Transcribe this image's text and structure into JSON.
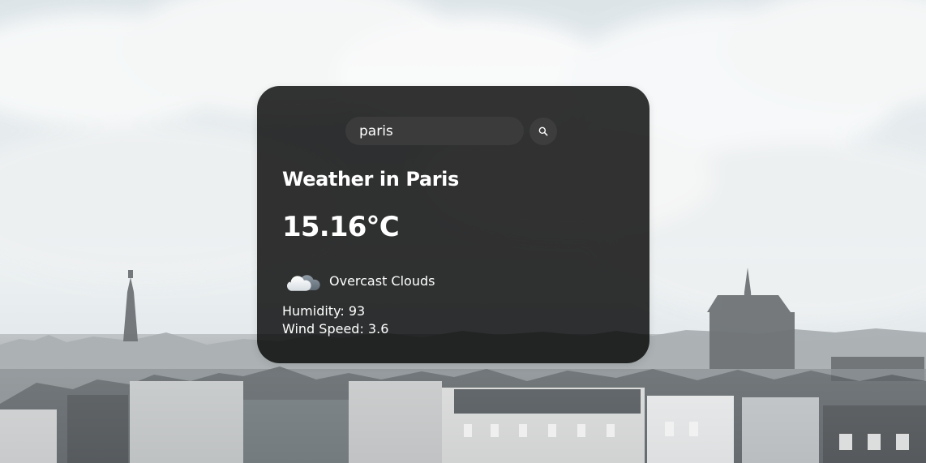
{
  "search": {
    "value": "paris",
    "placeholder": "Search"
  },
  "weather": {
    "title": "Weather in Paris",
    "temperature": "15.16°C",
    "condition": "Overcast Clouds",
    "condition_icon": "cloud-icon",
    "humidity": "Humidity: 93",
    "wind_speed": "Wind Speed: 3.6"
  },
  "theme": {
    "card_background": "#000000",
    "card_opacity": 0.8,
    "text_color": "#ffffff",
    "search_background": "#3b3b3b",
    "search_button_background": "#3d3d3d"
  },
  "icons": {
    "search": "search-icon",
    "weather": "cloud-icon"
  }
}
